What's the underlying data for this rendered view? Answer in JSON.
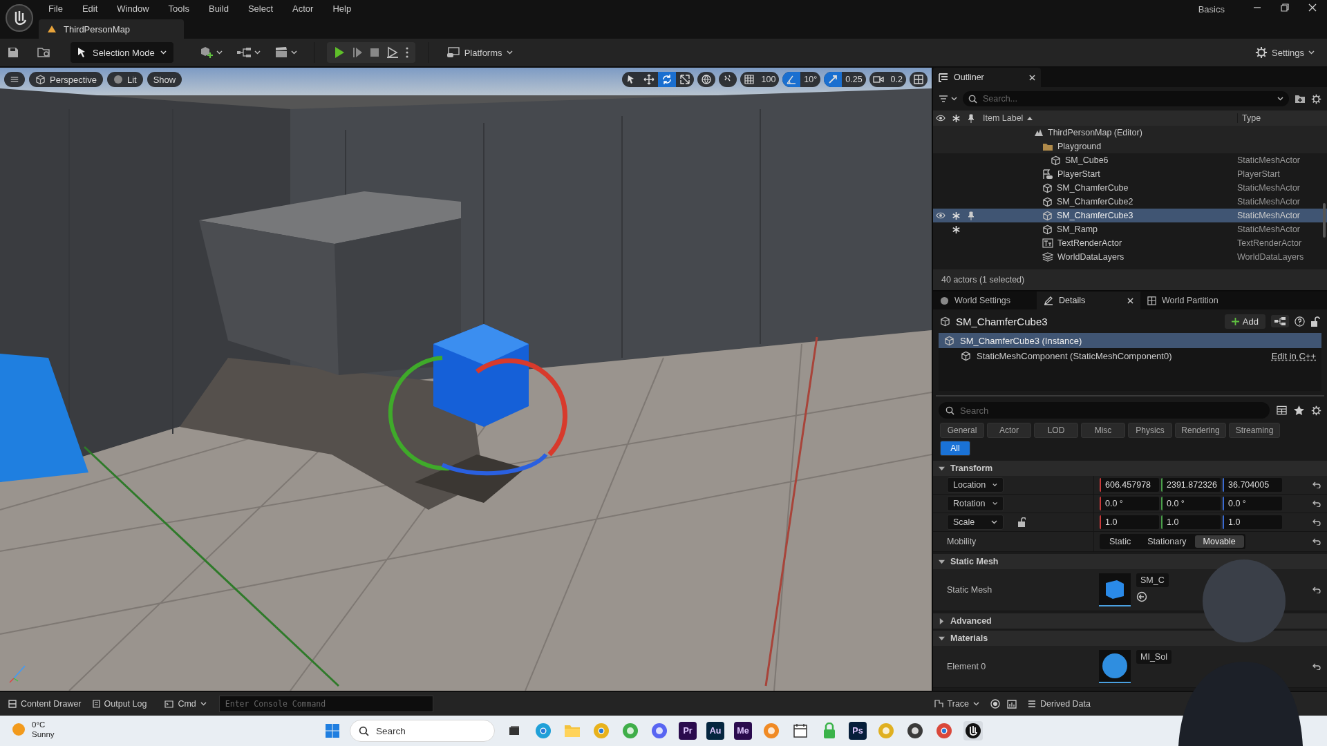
{
  "app": {
    "menu": [
      "File",
      "Edit",
      "Window",
      "Tools",
      "Build",
      "Select",
      "Actor",
      "Help"
    ],
    "document_tab": "ThirdPersonMap",
    "layout_name": "Basics"
  },
  "toolbar": {
    "mode": "Selection Mode",
    "platforms": "Platforms",
    "settings": "Settings"
  },
  "viewport": {
    "view_buttons": [
      "Perspective",
      "Lit",
      "Show"
    ],
    "tools": [
      {
        "kind": "select",
        "selected": false
      },
      {
        "kind": "move",
        "selected": false
      },
      {
        "kind": "rotate",
        "selected": true
      },
      {
        "kind": "scale",
        "selected": false
      }
    ],
    "snaps": [
      {
        "kind": "grid",
        "value": "100",
        "on": false
      },
      {
        "kind": "angle",
        "value": "10°",
        "on": true
      },
      {
        "kind": "scale",
        "value": "0.25",
        "on": true
      },
      {
        "kind": "camera",
        "value": "0.2",
        "on": false
      }
    ]
  },
  "outliner": {
    "title": "Outliner",
    "search": {
      "placeholder": "Search..."
    },
    "columns": [
      "Item Label",
      "Type"
    ],
    "rows": [
      {
        "label": "ThirdPersonMap (Editor)",
        "kind": "map",
        "selected": false,
        "starred": false,
        "children": [
          {
            "label": "Playground",
            "kind": "folder",
            "selected": false,
            "starred": false,
            "children": [
              {
                "label": "SM_Cube6",
                "kind": "mesh",
                "type": "StaticMeshActor",
                "selected": false,
                "starred": false
              }
            ]
          },
          {
            "label": "PlayerStart",
            "kind": "player",
            "type": "PlayerStart",
            "selected": false,
            "starred": false
          },
          {
            "label": "SM_ChamferCube",
            "kind": "mesh",
            "type": "StaticMeshActor",
            "selected": false,
            "starred": false
          },
          {
            "label": "SM_ChamferCube2",
            "kind": "mesh",
            "type": "StaticMeshActor",
            "selected": false,
            "starred": false
          },
          {
            "label": "SM_ChamferCube3",
            "kind": "mesh",
            "type": "StaticMeshActor",
            "selected": true,
            "starred": true
          },
          {
            "label": "SM_Ramp",
            "kind": "mesh",
            "type": "StaticMeshActor",
            "selected": false,
            "starred": true
          },
          {
            "label": "TextRenderActor",
            "kind": "text",
            "type": "TextRenderActor",
            "selected": false,
            "starred": false
          },
          {
            "label": "WorldDataLayers",
            "kind": "layers",
            "type": "WorldDataLayers",
            "selected": false,
            "starred": false
          }
        ]
      }
    ],
    "status": "40 actors (1 selected)"
  },
  "details": {
    "tabs": [
      {
        "label": "World Settings",
        "kind": "world",
        "selected": false
      },
      {
        "label": "Details",
        "kind": "details",
        "selected": true
      },
      {
        "label": "World Partition",
        "kind": "partition",
        "selected": false
      }
    ],
    "actor_name": "SM_ChamferCube3",
    "add_button": "Add",
    "components": [
      {
        "label": "SM_ChamferCube3 (Instance)",
        "selected": true
      },
      {
        "label": "StaticMeshComponent (StaticMeshComponent0)",
        "selected": false,
        "link": "Edit in C++"
      }
    ],
    "search": {
      "placeholder": "Search"
    },
    "filters": [
      {
        "label": "General",
        "selected": false
      },
      {
        "label": "Actor",
        "selected": false
      },
      {
        "label": "LOD",
        "selected": false
      },
      {
        "label": "Misc",
        "selected": false
      },
      {
        "label": "Physics",
        "selected": false
      },
      {
        "label": "Rendering",
        "selected": false
      },
      {
        "label": "Streaming",
        "selected": false
      },
      {
        "label": "All",
        "selected": true
      }
    ],
    "sections": [
      {
        "title": "Transform",
        "expanded": true,
        "rows": [
          {
            "kind": "vector",
            "label": "Location",
            "values": [
              "606.457978",
              "2391.872326",
              "36.704005"
            ]
          },
          {
            "kind": "vector",
            "label": "Rotation",
            "values": [
              "0.0 °",
              "0.0 °",
              "0.0 °"
            ]
          },
          {
            "kind": "vector",
            "label": "Scale",
            "values": [
              "1.0",
              "1.0",
              "1.0"
            ],
            "locked": false
          },
          {
            "kind": "mobility",
            "label": "Mobility",
            "options": [
              {
                "label": "Static",
                "selected": false
              },
              {
                "label": "Stationary",
                "selected": false
              },
              {
                "label": "Movable",
                "selected": true
              }
            ]
          }
        ]
      },
      {
        "title": "Static Mesh",
        "expanded": true,
        "rows": [
          {
            "kind": "asset",
            "label": "Static Mesh",
            "asset": "SM_C",
            "thumbnail": {
              "kind": "cube"
            }
          }
        ]
      },
      {
        "title": "Advanced",
        "expanded": false
      },
      {
        "title": "Materials",
        "expanded": true,
        "rows": [
          {
            "kind": "asset",
            "label": "Element 0",
            "asset": "MI_Sol",
            "thumbnail": {
              "kind": "sphere"
            }
          }
        ]
      }
    ]
  },
  "status_bar": {
    "buttons": [
      "Content Drawer",
      "Output Log"
    ],
    "cmd": "Cmd",
    "console": {
      "placeholder": "Enter Console Command"
    },
    "trace": "Trace",
    "derived_data": "Derived Data"
  },
  "taskbar": {
    "weather": {
      "temperature": "0°C",
      "condition": "Sunny"
    },
    "search": {
      "placeholder": "Search"
    },
    "apps": [
      {
        "kind": "taskview"
      },
      {
        "kind": "browser",
        "color": "#1fa0d8"
      },
      {
        "kind": "folder"
      },
      {
        "kind": "browser",
        "color": "#e8b21c"
      },
      {
        "kind": "round",
        "color": "#3fae49"
      },
      {
        "kind": "round",
        "color": "#5865f2"
      },
      {
        "kind": "tile",
        "label": "Pr",
        "color": "#2a0b4d"
      },
      {
        "kind": "tile",
        "label": "Au",
        "color": "#05263f"
      },
      {
        "kind": "tile",
        "label": "Me",
        "color": "#2a0b4d"
      },
      {
        "kind": "round",
        "color": "#f08a24"
      },
      {
        "kind": "calendar"
      },
      {
        "kind": "lock"
      },
      {
        "kind": "tile",
        "label": "Ps",
        "color": "#061e3a"
      },
      {
        "kind": "round",
        "color": "#e0b020"
      },
      {
        "kind": "round",
        "color": "#3a3a3a"
      },
      {
        "kind": "browser",
        "color": "#d9483b"
      },
      {
        "kind": "unreal"
      }
    ]
  }
}
